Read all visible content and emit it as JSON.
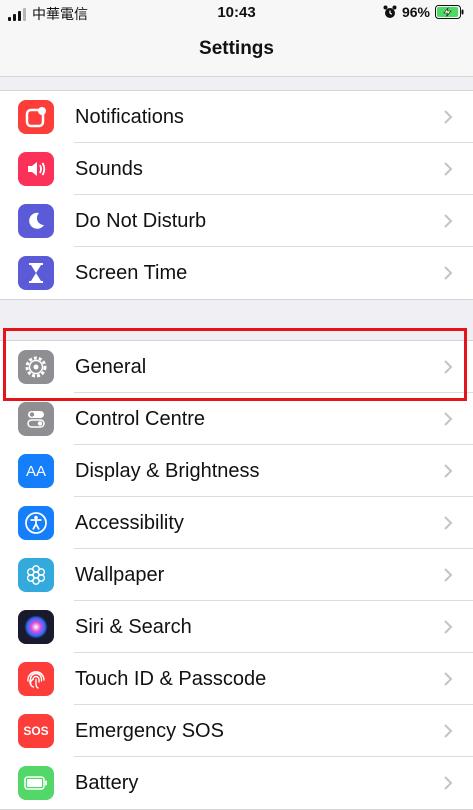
{
  "status_bar": {
    "carrier": "中華電信",
    "time": "10:43",
    "battery_percent": "96%",
    "battery_level": 0.96,
    "charging": true
  },
  "nav": {
    "title": "Settings"
  },
  "group1": [
    {
      "id": "notifications",
      "label": "Notifications",
      "icon": "notifications-icon",
      "color": "#fc3d39"
    },
    {
      "id": "sounds",
      "label": "Sounds",
      "icon": "speaker-icon",
      "color": "#fc3159"
    },
    {
      "id": "do-not-disturb",
      "label": "Do Not Disturb",
      "icon": "moon-icon",
      "color": "#5b5ad7"
    },
    {
      "id": "screen-time",
      "label": "Screen Time",
      "icon": "hourglass-icon",
      "color": "#5b5ad7"
    }
  ],
  "group2": [
    {
      "id": "general",
      "label": "General",
      "icon": "gear-icon",
      "color": "#8e8e93"
    },
    {
      "id": "control-centre",
      "label": "Control Centre",
      "icon": "switches-icon",
      "color": "#8e8e93"
    },
    {
      "id": "display-brightness",
      "label": "Display & Brightness",
      "icon": "aa-icon",
      "color": "#157efb",
      "icon_text": "AA"
    },
    {
      "id": "accessibility",
      "label": "Accessibility",
      "icon": "accessibility-icon",
      "color": "#157efb"
    },
    {
      "id": "wallpaper",
      "label": "Wallpaper",
      "icon": "flower-icon",
      "color": "#34aadc"
    },
    {
      "id": "siri-search",
      "label": "Siri & Search",
      "icon": "siri-icon",
      "color": "#1a1a2e"
    },
    {
      "id": "touch-id-passcode",
      "label": "Touch ID & Passcode",
      "icon": "fingerprint-icon",
      "color": "#fc3d39"
    },
    {
      "id": "emergency-sos",
      "label": "Emergency SOS",
      "icon": "sos-icon",
      "color": "#fc3d39",
      "icon_text": "SOS"
    },
    {
      "id": "battery",
      "label": "Battery",
      "icon": "battery-icon",
      "color": "#53d769"
    }
  ],
  "highlight": {
    "target": "general",
    "color": "#e3151b"
  }
}
